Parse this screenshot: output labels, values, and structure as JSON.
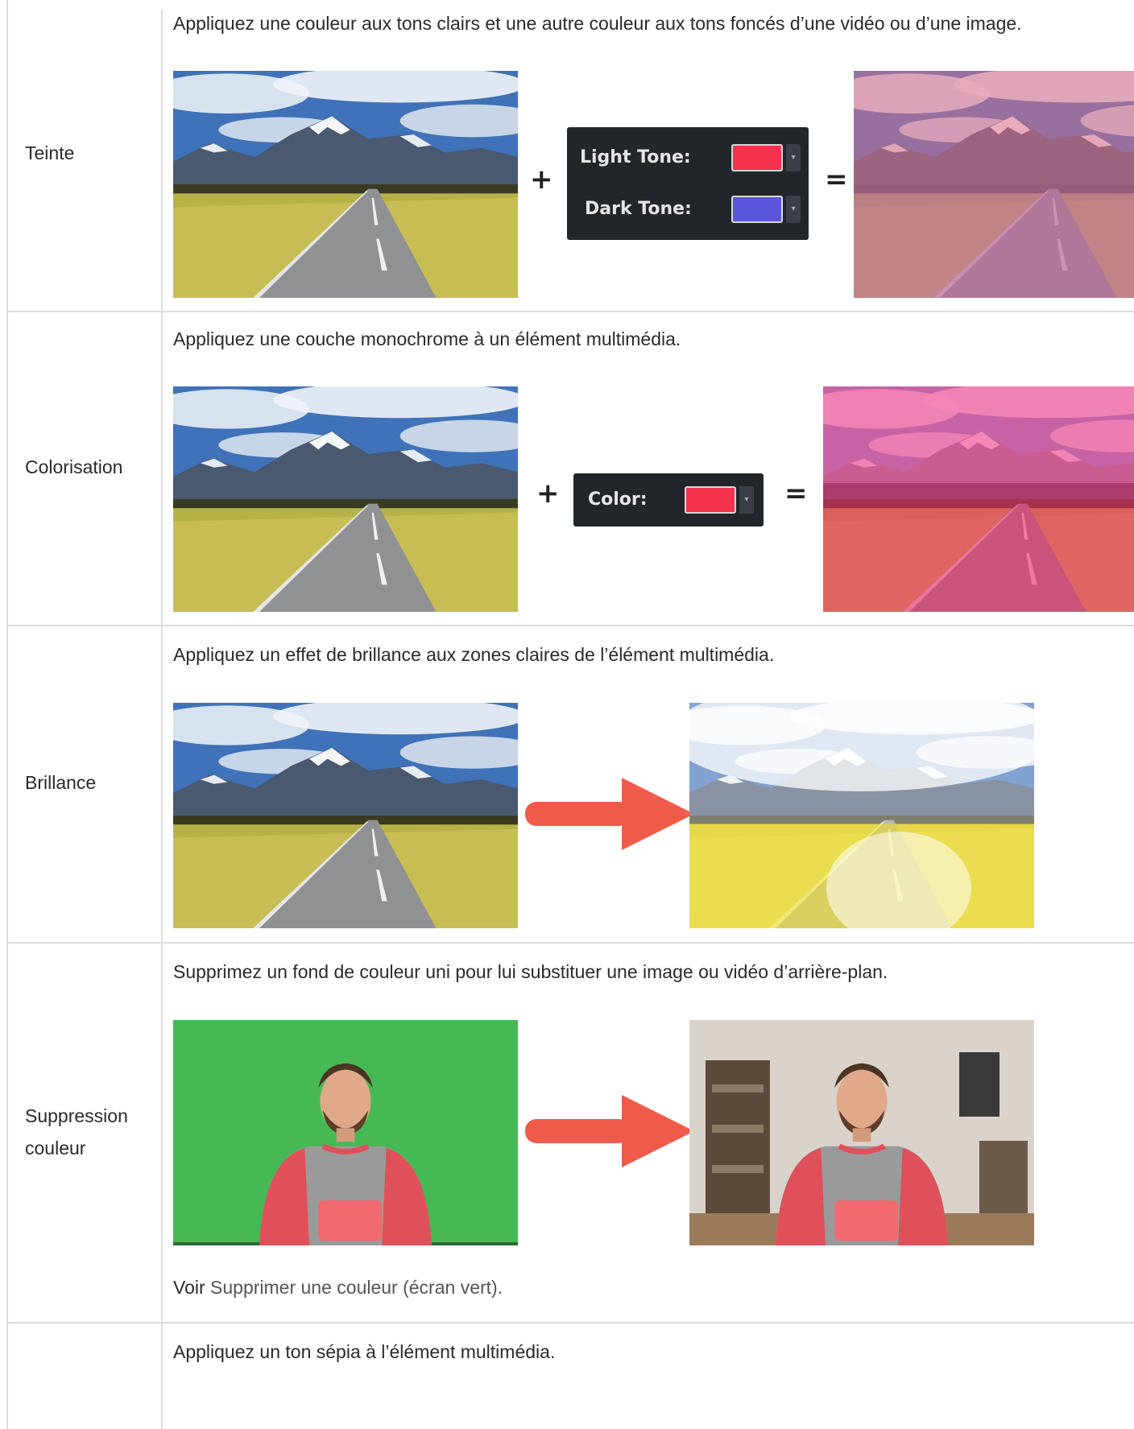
{
  "colors": {
    "light_tone": "#f5334f",
    "dark_tone": "#5b55dc",
    "colorize_color": "#f5334f",
    "arrow": "#f05a4a",
    "border": "#dcdcdc"
  },
  "rows": [
    {
      "name": "Teinte",
      "description": "Appliquez une couleur aux tons clairs et une autre couleur aux tons foncés d’une vidéo ou d’une image.",
      "operators": [
        "+",
        "="
      ],
      "panel": {
        "light_label": "Light Tone:",
        "dark_label": "Dark Tone:"
      }
    },
    {
      "name": "Colorisation",
      "description": "Appliquez une couche monochrome à un élément multimédia.",
      "operators": [
        "+",
        "="
      ],
      "panel": {
        "color_label": "Color:"
      }
    },
    {
      "name": "Brillance",
      "description": "Appliquez un effet de brillance aux zones claires de l’élément multimédia."
    },
    {
      "name_line1": "Suppression",
      "name_line2": "couleur",
      "description": "Supprimez un fond de couleur uni pour lui substituer une image ou vidéo d’arrière-plan.",
      "see_prefix": "Voir",
      "see_link": "Supprimer une couleur (écran vert)."
    },
    {
      "description": "Appliquez un ton sépia à l’élément multimédia."
    }
  ]
}
